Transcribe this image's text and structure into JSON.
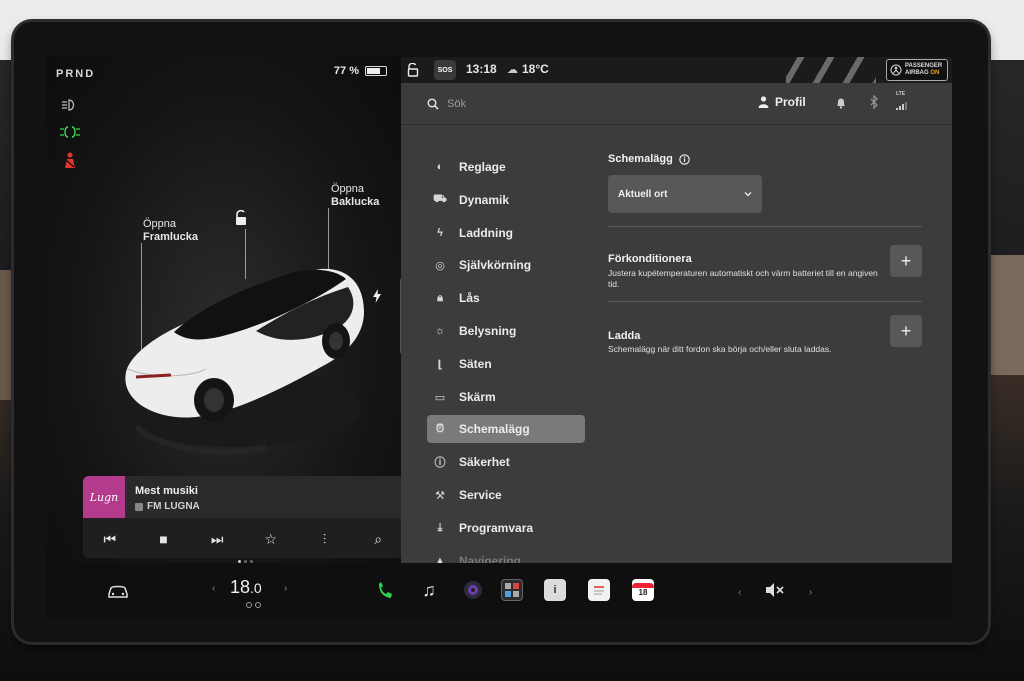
{
  "status": {
    "gear": "PRND",
    "battery_percent": "77 %",
    "battery_level": 0.77,
    "sos": "SOS",
    "time": "13:18",
    "weather_temp": "18°C",
    "airbag_line1": "PASSENGER",
    "airbag_line2": "AIRBAG",
    "airbag_state": "ON"
  },
  "car_view": {
    "frunk_line1": "Öppna",
    "frunk_line2": "Framlucka",
    "trunk_line1": "Öppna",
    "trunk_line2": "Baklucka"
  },
  "media": {
    "art_text": "Lugn",
    "title": "Mest musiki",
    "station": "FM LUGNA"
  },
  "header": {
    "search_placeholder": "Sök",
    "profile_label": "Profil",
    "lte_label": "LTE"
  },
  "nav": {
    "items": [
      {
        "label": "Reglage",
        "icon": "toggle-icon"
      },
      {
        "label": "Dynamik",
        "icon": "car-icon"
      },
      {
        "label": "Laddning",
        "icon": "bolt-icon"
      },
      {
        "label": "Självkörning",
        "icon": "steering-wheel-icon"
      },
      {
        "label": "Lås",
        "icon": "lock-icon"
      },
      {
        "label": "Belysning",
        "icon": "sun-icon"
      },
      {
        "label": "Säten",
        "icon": "seat-icon"
      },
      {
        "label": "Skärm",
        "icon": "display-icon"
      },
      {
        "label": "Schemalägg",
        "icon": "alarm-clock-icon",
        "active": true
      },
      {
        "label": "Säkerhet",
        "icon": "info-circle-icon"
      },
      {
        "label": "Service",
        "icon": "wrench-icon"
      },
      {
        "label": "Programvara",
        "icon": "download-icon"
      },
      {
        "label": "Navigering",
        "icon": "navigation-icon"
      }
    ]
  },
  "schedule": {
    "title": "Schemalägg",
    "dropdown_value": "Aktuell ort",
    "precondition_title": "Förkonditionera",
    "precondition_desc": "Justera kupétemperaturen automatiskt och värm batteriet till en angiven tid.",
    "charge_title": "Ladda",
    "charge_desc": "Schemalägg när ditt fordon ska börja och/eller sluta laddas."
  },
  "dock": {
    "cabin_temp_int": "18",
    "cabin_temp_dec": ".0",
    "calendar_day": "18"
  },
  "colors": {
    "accent_active": "#7a7a7d",
    "headlight_green": "#3ddc4a",
    "seatbelt_red": "#e0352b",
    "phone_green": "#2fd14a",
    "airbag_on": "#f0a020"
  }
}
